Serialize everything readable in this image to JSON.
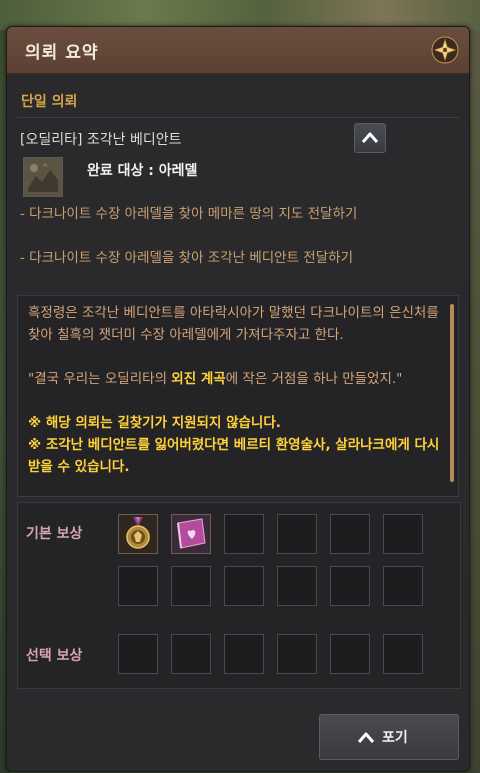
{
  "window": {
    "title": "의뢰 요약"
  },
  "quest": {
    "section_label": "단일 의뢰",
    "name": "[오딜리타] 조각난 베디안트",
    "completion_target": "완료 대상 : 아레델",
    "objectives": [
      "- 다크나이트 수장 아레델을 찾아 메마른 땅의 지도 전달하기",
      "- 다크나이트 수장 아레델을 찾아 조각난 베디안트 전달하기"
    ],
    "description": {
      "paragraph1": "흑정령은 조각난 베디안트를 아타락시아가 말했던 다크나이트의 은신처를 찾아 칠흑의 잿더미 수장 아레델에게 가져다주자고 한다.",
      "quote_before": "\"결국 우리는 오딜리타의 ",
      "quote_highlight": "외진 계곡",
      "quote_after": "에 작은 거점을 하나 만들었지.\"",
      "notice1": "※ 해당 의뢰는 길찾기가 지원되지 않습니다.",
      "notice2": "※ 조각난 베디안트를 잃어버렸다면 베르티 환영술사, 살라나크에게 다시 받을 수 있습니다."
    }
  },
  "rewards": {
    "basic_label": "기본 보상",
    "choice_label": "선택 보상",
    "basic_items": [
      "medal-icon",
      "scroll-icon"
    ]
  },
  "footer": {
    "give_up_label": "포기"
  },
  "colors": {
    "title_bar": "#6a4d3e",
    "section_accent": "#d7a44a",
    "description_text": "#d3a57b",
    "highlight": "#ffd23a",
    "reward_label": "#d7a4b4"
  }
}
